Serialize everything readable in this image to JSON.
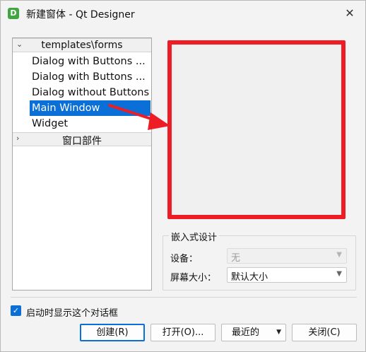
{
  "window": {
    "app_icon_letter": "D",
    "title": "新建窗体 - Qt Designer",
    "close_glyph": "✕"
  },
  "tree": {
    "categories": [
      {
        "label": "templates\\forms",
        "arrow": "⌄"
      },
      {
        "label": "窗口部件",
        "arrow": "›"
      }
    ],
    "items": [
      {
        "label": "Dialog with Buttons ..."
      },
      {
        "label": "Dialog with Buttons ..."
      },
      {
        "label": "Dialog without Buttons"
      },
      {
        "label": "Main Window"
      },
      {
        "label": "Widget"
      }
    ],
    "selected_index": 3
  },
  "embedded": {
    "title": "嵌入式设计",
    "device_label": "设备：",
    "device_value": "无",
    "screen_label": "屏幕大小：",
    "screen_value": "默认大小"
  },
  "footer": {
    "show_dialog_label": "启动时显示这个对话框",
    "checked": true,
    "buttons": {
      "create": "创建(R)",
      "open": "打开(O)...",
      "recent": "最近的",
      "close": "关闭(C)"
    }
  },
  "colors": {
    "accent": "#0a6fd6",
    "annotation_red": "#ee1c25"
  }
}
